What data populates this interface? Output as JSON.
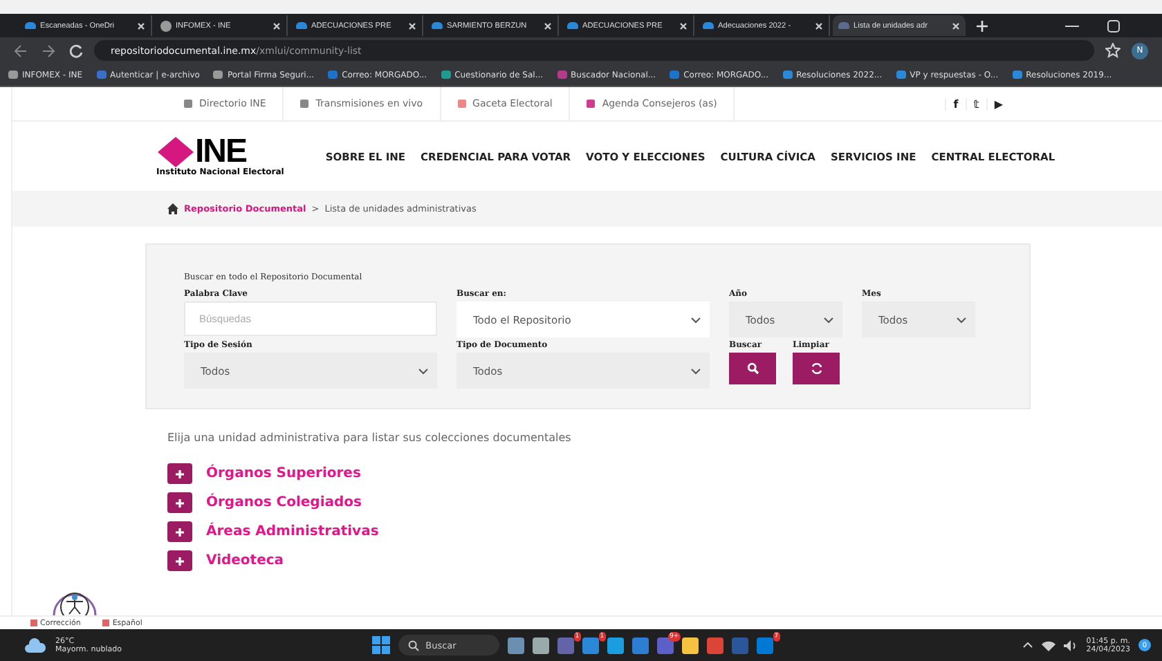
{
  "browser": {
    "tabs": [
      {
        "title": "Escaneadas - OneDri",
        "kind": "cloud",
        "selected": false
      },
      {
        "title": "INFOMEX - INE",
        "kind": "globe",
        "selected": false
      },
      {
        "title": "ADECUACIONES PRE",
        "kind": "cloud",
        "selected": false
      },
      {
        "title": "SARMIENTO BERZUN",
        "kind": "cloud",
        "selected": false
      },
      {
        "title": "ADECUACIONES PRE",
        "kind": "cloud",
        "selected": false
      },
      {
        "title": "Adecuaciones 2022 -",
        "kind": "cloud",
        "selected": false
      },
      {
        "title": "Lista de unidades adr",
        "kind": "page",
        "selected": true
      }
    ],
    "url_host": "repositoriodocumental.ine.mx",
    "url_path": "/xmlui/community-list",
    "profile_initial": "N",
    "bookmarks": [
      {
        "label": "INFOMEX - INE",
        "kind": "globe"
      },
      {
        "label": "Autenticar | e-archivo",
        "kind": "doc"
      },
      {
        "label": "Portal Firma Seguri...",
        "kind": "globe"
      },
      {
        "label": "Correo: MORGADO...",
        "kind": "mail"
      },
      {
        "label": "Cuestionario de Sal...",
        "kind": "form"
      },
      {
        "label": "Buscador Nacional...",
        "kind": "search"
      },
      {
        "label": "Correo: MORGADO...",
        "kind": "mail"
      },
      {
        "label": "Resoluciones 2022...",
        "kind": "cloud"
      },
      {
        "label": "VP y respuestas - O...",
        "kind": "cloud"
      },
      {
        "label": "Resoluciones 2019...",
        "kind": "cloud"
      }
    ]
  },
  "topbar": {
    "links": [
      {
        "label": "Directorio INE",
        "kind": "people"
      },
      {
        "label": "Transmisiones en vivo",
        "kind": "video"
      },
      {
        "label": "Gaceta Electoral",
        "kind": "doc"
      },
      {
        "label": "Agenda Consejeros (as)",
        "kind": "calendar"
      }
    ],
    "social": [
      "f",
      "𝕥",
      "▶"
    ]
  },
  "logo": {
    "name": "INE",
    "subtitle": "Instituto Nacional Electoral"
  },
  "nav": [
    "SOBRE EL INE",
    "CREDENCIAL PARA VOTAR",
    "VOTO Y ELECCIONES",
    "CULTURA CÍVICA",
    "SERVICIOS INE",
    "CENTRAL ELECTORAL"
  ],
  "breadcrumb": {
    "home": "Repositorio Documental",
    "separator": ">",
    "current": "Lista de unidades administrativas"
  },
  "search": {
    "heading": "Buscar en todo el Repositorio Documental",
    "fields": [
      {
        "label": "Palabra Clave",
        "kind": "text",
        "placeholder": "Búsquedas"
      },
      {
        "label": "Buscar en:",
        "kind": "select",
        "value": "Todo el Repositorio",
        "white": true
      },
      {
        "label": "Año",
        "kind": "select",
        "value": "Todos",
        "white": false
      },
      {
        "label": "Mes",
        "kind": "select",
        "value": "Todos",
        "white": false
      },
      {
        "label": "Tipo de Sesión",
        "kind": "select",
        "value": "Todos",
        "white": false
      },
      {
        "label": "Tipo de Documento",
        "kind": "select",
        "value": "Todos",
        "white": false
      },
      {
        "label": "Buscar",
        "kind": "search"
      },
      {
        "label": "Limpiar",
        "kind": "reset"
      }
    ]
  },
  "intro": "Elija una unidad administrativa para listar sus colecciones documentales",
  "units": [
    {
      "label": "Órganos Superiores"
    },
    {
      "label": "Órganos Colegiados"
    },
    {
      "label": "Áreas Administrativas"
    },
    {
      "label": "Videoteca"
    }
  ],
  "footer_bar": [
    "Corrección",
    "Español"
  ],
  "taskbar": {
    "temperature": "26°C",
    "weather": "Mayorm. nublado",
    "search": "Buscar",
    "apps": [
      {
        "kind": "photos"
      },
      {
        "kind": "window"
      },
      {
        "kind": "chat",
        "badge": "1"
      },
      {
        "kind": "mail",
        "badge": "1"
      },
      {
        "kind": "edge"
      },
      {
        "kind": "store"
      },
      {
        "kind": "teams",
        "badge": "9+"
      },
      {
        "kind": "folder"
      },
      {
        "kind": "chrome"
      },
      {
        "kind": "word"
      },
      {
        "kind": "skype",
        "badge": "7"
      }
    ],
    "time": "01:45 p. m.",
    "date": "24/04/2023",
    "notifications": "0"
  }
}
